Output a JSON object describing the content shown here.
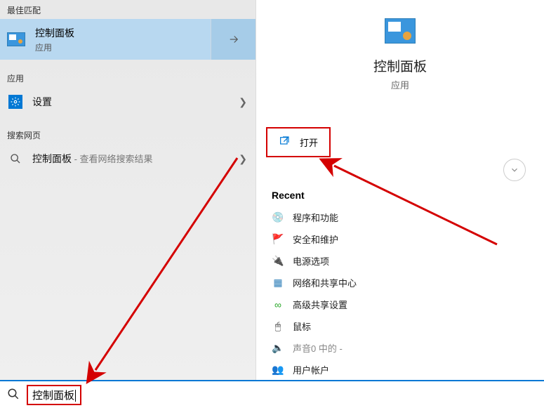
{
  "left": {
    "section_best": "最佳匹配",
    "best_match": {
      "title": "控制面板",
      "sub": "应用"
    },
    "section_apps": "应用",
    "apps": [
      {
        "label": "设置"
      }
    ],
    "section_web": "搜索网页",
    "web": [
      {
        "label": "控制面板",
        "secondary": " - 查看网络搜索结果"
      }
    ]
  },
  "right": {
    "title": "控制面板",
    "sub": "应用",
    "open": "打开",
    "recent_header": "Recent",
    "recent": [
      {
        "label": "程序和功能"
      },
      {
        "label": "安全和维护"
      },
      {
        "label": "电源选项"
      },
      {
        "label": "网络和共享中心"
      },
      {
        "label": "高级共享设置"
      },
      {
        "label": "鼠标"
      },
      {
        "label": "声音0 中的 -",
        "dim": true
      },
      {
        "label": "用户帐户"
      }
    ]
  },
  "search": {
    "value": "控制面板"
  },
  "accent": "#d40000"
}
